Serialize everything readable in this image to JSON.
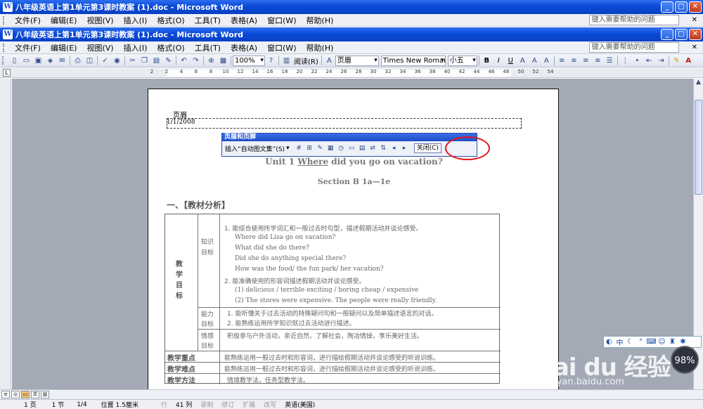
{
  "outer_window": {
    "title": "八年级英语上第1单元第3课时教案 (1).doc - Microsoft Word"
  },
  "inner_window": {
    "title": "八年级英语上第1单元第3课时教案 (1).doc - Microsoft Word"
  },
  "menu": {
    "items": [
      "文件(F)",
      "编辑(E)",
      "视图(V)",
      "插入(I)",
      "格式(O)",
      "工具(T)",
      "表格(A)",
      "窗口(W)",
      "帮助(H)"
    ],
    "help_placeholder": "键入需要帮助的问题"
  },
  "toolbar": {
    "zoom": "100%",
    "read_label": "阅读(R)",
    "style": "页眉",
    "font": "Times New Roman",
    "size": "小五",
    "bold": "B",
    "italic": "I",
    "underline": "U",
    "font_color": "A"
  },
  "ruler": {
    "h_numbers": [
      "2",
      "2",
      "4",
      "6",
      "8",
      "10",
      "12",
      "14",
      "16",
      "18",
      "20",
      "22",
      "24",
      "26",
      "28",
      "30",
      "32",
      "34",
      "36",
      "38",
      "40",
      "42",
      "44",
      "46",
      "48",
      "50",
      "52",
      "54"
    ]
  },
  "header": {
    "label": "页眉",
    "date": "1/1/2008"
  },
  "hf_toolbar": {
    "title": "页眉和页脚",
    "insert_label": "插入“自动图文集”(S)",
    "close_label": "关闭(C)"
  },
  "doc": {
    "title_pre": "Unit 1 ",
    "title_u": "Where",
    "title_post": " did you go on vacation?",
    "section": "Section B 1a—1e",
    "heading": "一、【教材分析】",
    "goal_label": [
      "教",
      "学",
      "目",
      "标"
    ],
    "knowledge_label": [
      "知识",
      "目标"
    ],
    "knowledge": [
      "1.  能综合使用所学词汇和一般过去时句型，描述假期活动并谈论感受。",
      "Where did Lisa go on vacation?",
      "What did she do there?",
      "Did she do anything special there?",
      "How was the food/ the fun park/ her vacation?",
      "2.  能准确使用的形容词描述假期活动并谈论感受。",
      "(1) delicious / terrible        exciting / boring         cheap / expensive",
      "(2) The stores were expensive. The people were really friendly."
    ],
    "ability_label": [
      "能力",
      "目标"
    ],
    "ability": [
      "1.  能听懂关于过去活动的特殊疑问句和一般疑问以及简单描述语言的对话。",
      "2.  能熟练运用所学知识就过去活动进行描述。"
    ],
    "emotion_label": [
      "情感",
      "目标"
    ],
    "emotion": "积极参与户外活动，亲近自然，了解社会，陶冶情操，享乐美好生活。",
    "key_label": "教学重点",
    "key_text": "能熟练运用一般过去时和形容词，进行描绘假期活动并谈论感受的听说训练。",
    "diff_label": "教学难点",
    "diff_text": "能熟练运用一般过去时和形容词，进行描绘假期活动并谈论感受的听说训练。",
    "method_label": "教学方法",
    "method_text": "情境教学法，任务型教学法。"
  },
  "status": {
    "page": "1 页",
    "section": "1 节",
    "page_of": "1/4",
    "position": "位置 1.5厘米",
    "line": "行",
    "col": "41 列",
    "rec": "录制",
    "trk": "修订",
    "ext": "扩展",
    "ovr": "改写",
    "lang": "英语(美国)"
  },
  "ime": {
    "mode": "中"
  },
  "badge": {
    "value": "98%"
  },
  "watermark": {
    "text": "Bai du 经验",
    "url": "jingyan.baidu.com"
  }
}
